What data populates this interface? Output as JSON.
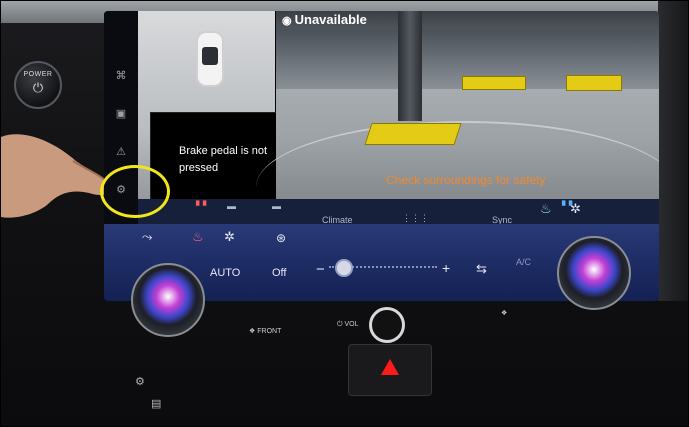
{
  "power_button": {
    "label": "POWER",
    "icon": "power-icon"
  },
  "camera_view": {
    "status_icon": "camera-unavailable-icon",
    "status_text": "Unavailable",
    "warning_text": "Check surroundings for safety"
  },
  "brake_message": "Brake pedal is not pressed",
  "climate_tabs": {
    "climate_label": "Climate",
    "apps_icon": "grid-icon",
    "sync_label": "Sync"
  },
  "climate_controls": {
    "auto_label": "AUTO",
    "off_label": "Off",
    "minus_label": "−",
    "plus_label": "+",
    "ac_label": "A/C"
  },
  "hardware_labels": {
    "front_defrost": "FRONT",
    "volume": "VOL"
  },
  "colors": {
    "highlight_ring": "#f2e61a",
    "warning": "#f08a2b",
    "hazard": "#ff1a1a",
    "panel": "#1c2a62"
  }
}
